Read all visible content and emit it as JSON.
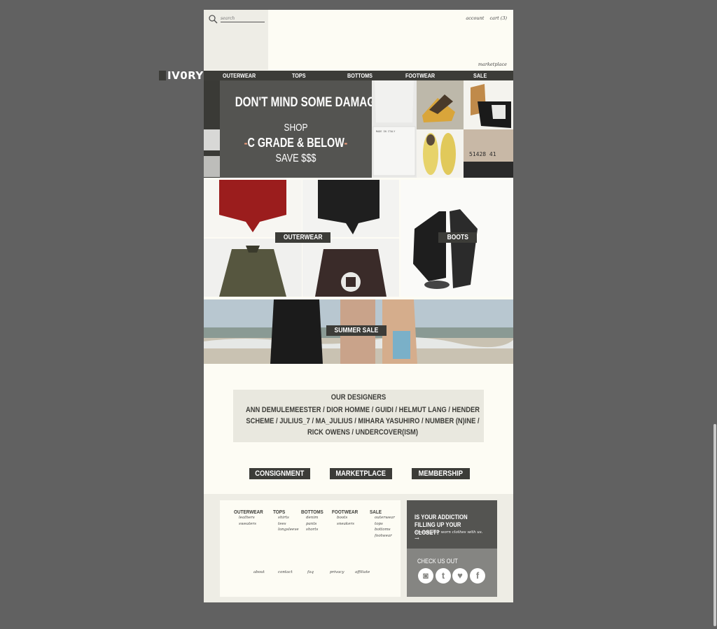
{
  "header": {
    "search_placeholder": "search",
    "account": "account",
    "cart": "cart",
    "cart_count": "(3)",
    "marketplace": "marketplace"
  },
  "logo": "IV0RY",
  "nav": [
    "OUTERWEAR",
    "TOPS",
    "BOTTOMS",
    "FOOTWEAR",
    "SALE"
  ],
  "hero": {
    "title": "DON'T MIND SOME DAMAGE?",
    "shop": "SHOP",
    "dash_left": "-",
    "grade": "C GRADE & BELOW",
    "dash_right": "-",
    "save": "SAVE $$$",
    "tag_text": "MADE IN ITALY",
    "shoe_number": "51428 41"
  },
  "categories": {
    "outerwear": "OUTERWEAR",
    "boots": "BOOTS",
    "summer_sale": "SUMMER SALE"
  },
  "designers": {
    "title": "OUR DESIGNERS",
    "list": "ANN DEMULEMEESTER /  DIOR HOMME /  GUIDI /  HELMUT LANG /  HENDER SCHEME /  JULIUS_7 /  MA_JULIUS /  MIHARA YASUHIRO /  NUMBER (N)INE /  RICK OWENS /  UNDERCOVER(ISM)"
  },
  "cta": [
    "CONSIGNMENT",
    "MARKETPLACE",
    "MEMBERSHIP"
  ],
  "footer": {
    "columns": [
      {
        "head": "OUTERWEAR",
        "items": [
          "leathers",
          "sweaters"
        ]
      },
      {
        "head": "TOPS",
        "items": [
          "shirts",
          "tees",
          "longsleeve"
        ]
      },
      {
        "head": "BOTTOMS",
        "items": [
          "denim",
          "pants",
          "shorts"
        ]
      },
      {
        "head": "FOOTWEAR",
        "items": [
          "boots",
          "sneakers"
        ]
      },
      {
        "head": "SALE",
        "items": [
          "outerwear",
          "tops",
          "bottoms",
          "footwear"
        ]
      }
    ],
    "bottom_links": [
      "about",
      "contact",
      "faq",
      "privacy",
      "affiliate"
    ],
    "promo_title": "IS YOUR ADDICTION FILLING UP YOUR CLOSET?",
    "promo_sub": "consign your worn clothes with us.",
    "promo_arrow": "→",
    "social_title": "CHECK US OUT",
    "social_icons": [
      "instagram-icon",
      "tumblr-icon",
      "twitter-icon",
      "facebook-icon"
    ],
    "social_glyphs": [
      "◙",
      "t",
      "♥",
      "f"
    ]
  },
  "colors": {
    "background": "#616161",
    "page": "#fdfcf4",
    "dark": "#3c3c38",
    "panel": "#545451",
    "accent": "#e89a7a"
  }
}
